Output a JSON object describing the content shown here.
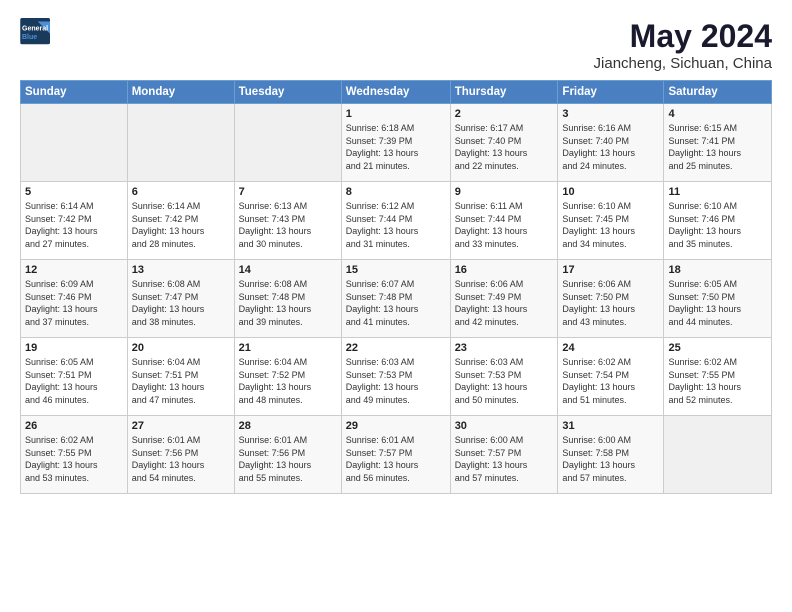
{
  "logo": {
    "text_general": "General",
    "text_blue": "Blue"
  },
  "header": {
    "title": "May 2024",
    "subtitle": "Jiancheng, Sichuan, China"
  },
  "weekdays": [
    "Sunday",
    "Monday",
    "Tuesday",
    "Wednesday",
    "Thursday",
    "Friday",
    "Saturday"
  ],
  "weeks": [
    [
      {
        "day": "",
        "info": ""
      },
      {
        "day": "",
        "info": ""
      },
      {
        "day": "",
        "info": ""
      },
      {
        "day": "1",
        "info": "Sunrise: 6:18 AM\nSunset: 7:39 PM\nDaylight: 13 hours\nand 21 minutes."
      },
      {
        "day": "2",
        "info": "Sunrise: 6:17 AM\nSunset: 7:40 PM\nDaylight: 13 hours\nand 22 minutes."
      },
      {
        "day": "3",
        "info": "Sunrise: 6:16 AM\nSunset: 7:40 PM\nDaylight: 13 hours\nand 24 minutes."
      },
      {
        "day": "4",
        "info": "Sunrise: 6:15 AM\nSunset: 7:41 PM\nDaylight: 13 hours\nand 25 minutes."
      }
    ],
    [
      {
        "day": "5",
        "info": "Sunrise: 6:14 AM\nSunset: 7:42 PM\nDaylight: 13 hours\nand 27 minutes."
      },
      {
        "day": "6",
        "info": "Sunrise: 6:14 AM\nSunset: 7:42 PM\nDaylight: 13 hours\nand 28 minutes."
      },
      {
        "day": "7",
        "info": "Sunrise: 6:13 AM\nSunset: 7:43 PM\nDaylight: 13 hours\nand 30 minutes."
      },
      {
        "day": "8",
        "info": "Sunrise: 6:12 AM\nSunset: 7:44 PM\nDaylight: 13 hours\nand 31 minutes."
      },
      {
        "day": "9",
        "info": "Sunrise: 6:11 AM\nSunset: 7:44 PM\nDaylight: 13 hours\nand 33 minutes."
      },
      {
        "day": "10",
        "info": "Sunrise: 6:10 AM\nSunset: 7:45 PM\nDaylight: 13 hours\nand 34 minutes."
      },
      {
        "day": "11",
        "info": "Sunrise: 6:10 AM\nSunset: 7:46 PM\nDaylight: 13 hours\nand 35 minutes."
      }
    ],
    [
      {
        "day": "12",
        "info": "Sunrise: 6:09 AM\nSunset: 7:46 PM\nDaylight: 13 hours\nand 37 minutes."
      },
      {
        "day": "13",
        "info": "Sunrise: 6:08 AM\nSunset: 7:47 PM\nDaylight: 13 hours\nand 38 minutes."
      },
      {
        "day": "14",
        "info": "Sunrise: 6:08 AM\nSunset: 7:48 PM\nDaylight: 13 hours\nand 39 minutes."
      },
      {
        "day": "15",
        "info": "Sunrise: 6:07 AM\nSunset: 7:48 PM\nDaylight: 13 hours\nand 41 minutes."
      },
      {
        "day": "16",
        "info": "Sunrise: 6:06 AM\nSunset: 7:49 PM\nDaylight: 13 hours\nand 42 minutes."
      },
      {
        "day": "17",
        "info": "Sunrise: 6:06 AM\nSunset: 7:50 PM\nDaylight: 13 hours\nand 43 minutes."
      },
      {
        "day": "18",
        "info": "Sunrise: 6:05 AM\nSunset: 7:50 PM\nDaylight: 13 hours\nand 44 minutes."
      }
    ],
    [
      {
        "day": "19",
        "info": "Sunrise: 6:05 AM\nSunset: 7:51 PM\nDaylight: 13 hours\nand 46 minutes."
      },
      {
        "day": "20",
        "info": "Sunrise: 6:04 AM\nSunset: 7:51 PM\nDaylight: 13 hours\nand 47 minutes."
      },
      {
        "day": "21",
        "info": "Sunrise: 6:04 AM\nSunset: 7:52 PM\nDaylight: 13 hours\nand 48 minutes."
      },
      {
        "day": "22",
        "info": "Sunrise: 6:03 AM\nSunset: 7:53 PM\nDaylight: 13 hours\nand 49 minutes."
      },
      {
        "day": "23",
        "info": "Sunrise: 6:03 AM\nSunset: 7:53 PM\nDaylight: 13 hours\nand 50 minutes."
      },
      {
        "day": "24",
        "info": "Sunrise: 6:02 AM\nSunset: 7:54 PM\nDaylight: 13 hours\nand 51 minutes."
      },
      {
        "day": "25",
        "info": "Sunrise: 6:02 AM\nSunset: 7:55 PM\nDaylight: 13 hours\nand 52 minutes."
      }
    ],
    [
      {
        "day": "26",
        "info": "Sunrise: 6:02 AM\nSunset: 7:55 PM\nDaylight: 13 hours\nand 53 minutes."
      },
      {
        "day": "27",
        "info": "Sunrise: 6:01 AM\nSunset: 7:56 PM\nDaylight: 13 hours\nand 54 minutes."
      },
      {
        "day": "28",
        "info": "Sunrise: 6:01 AM\nSunset: 7:56 PM\nDaylight: 13 hours\nand 55 minutes."
      },
      {
        "day": "29",
        "info": "Sunrise: 6:01 AM\nSunset: 7:57 PM\nDaylight: 13 hours\nand 56 minutes."
      },
      {
        "day": "30",
        "info": "Sunrise: 6:00 AM\nSunset: 7:57 PM\nDaylight: 13 hours\nand 57 minutes."
      },
      {
        "day": "31",
        "info": "Sunrise: 6:00 AM\nSunset: 7:58 PM\nDaylight: 13 hours\nand 57 minutes."
      },
      {
        "day": "",
        "info": ""
      }
    ]
  ]
}
